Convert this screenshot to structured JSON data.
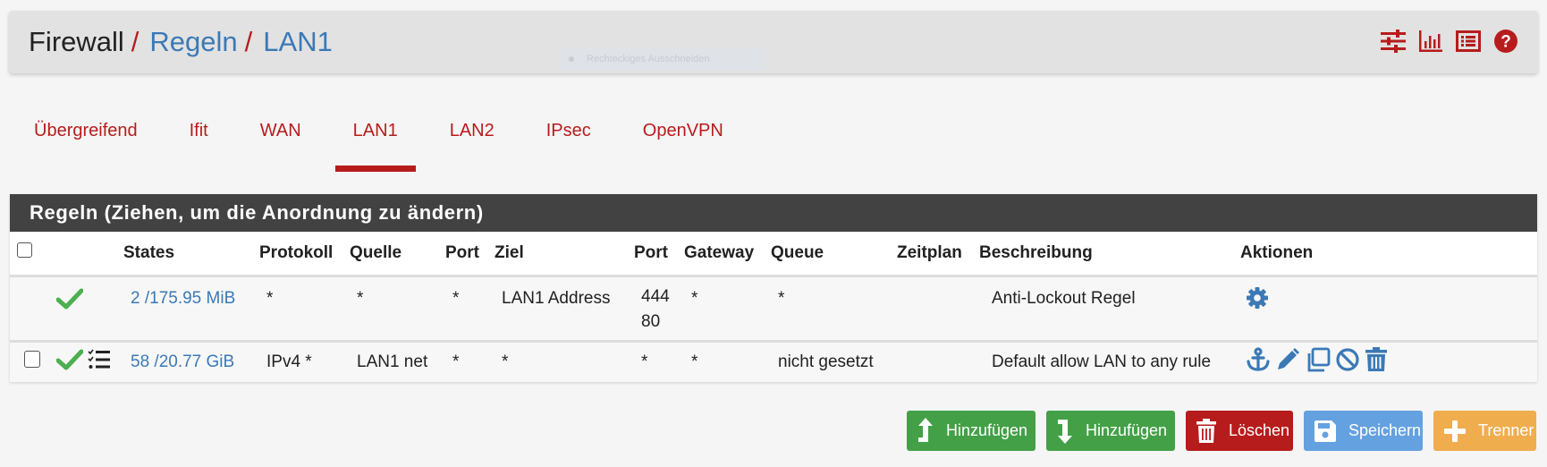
{
  "header": {
    "breadcrumb": [
      {
        "label": "Firewall",
        "link": false
      },
      {
        "label": "Regeln",
        "link": true
      },
      {
        "label": "LAN1",
        "link": true
      }
    ],
    "separator": "/",
    "ghost_tooltip": "Rechteckiges Ausschneiden",
    "icons": [
      "sliders-icon",
      "bar-chart-icon",
      "list-alt-icon",
      "help-icon"
    ]
  },
  "tabs": [
    {
      "label": "Übergreifend",
      "active": false
    },
    {
      "label": "Ifit",
      "active": false
    },
    {
      "label": "WAN",
      "active": false
    },
    {
      "label": "LAN1",
      "active": true
    },
    {
      "label": "LAN2",
      "active": false
    },
    {
      "label": "IPsec",
      "active": false
    },
    {
      "label": "OpenVPN",
      "active": false
    }
  ],
  "panel": {
    "title": "Regeln (Ziehen, um die Anordnung zu ändern)",
    "columns": [
      "",
      "",
      "States",
      "Protokoll",
      "Quelle",
      "Port",
      "Ziel",
      "Port",
      "Gateway",
      "Queue",
      "Zeitplan",
      "Beschreibung",
      "Aktionen"
    ],
    "rows": [
      {
        "selectable": false,
        "status": "pass",
        "has_advanced": false,
        "states": "2 /175.95 MiB",
        "protocol": "*",
        "source": "*",
        "source_port": "*",
        "destination": "LAN1 Address",
        "destination_port_line1": "444",
        "destination_port_line2": "80",
        "gateway": "*",
        "queue": "*",
        "schedule": "",
        "description": "Anti-Lockout Regel",
        "actions": [
          "settings-icon"
        ]
      },
      {
        "selectable": true,
        "status": "pass",
        "has_advanced": true,
        "states": "58 /20.77 GiB",
        "protocol": "IPv4 *",
        "source": "LAN1 net",
        "source_port": "*",
        "destination": "*",
        "destination_port_line1": "*",
        "destination_port_line2": "",
        "gateway": "*",
        "queue": "nicht gesetzt",
        "schedule": "",
        "description": "Default allow LAN to any rule",
        "actions": [
          "anchor-icon",
          "edit-icon",
          "copy-icon",
          "disable-icon",
          "delete-icon"
        ]
      }
    ]
  },
  "buttons": {
    "add_top": "Hinzufügen",
    "add_bottom": "Hinzufügen",
    "delete": "Löschen",
    "save": "Speichern",
    "separator": "Trenner"
  },
  "colors": {
    "accent_red": "#b71c1c",
    "link_blue": "#3b79b6",
    "success_green": "#43a047",
    "save_blue": "#64a1e0",
    "separator_orange": "#f0ad4e",
    "panel_heading": "#424242"
  }
}
